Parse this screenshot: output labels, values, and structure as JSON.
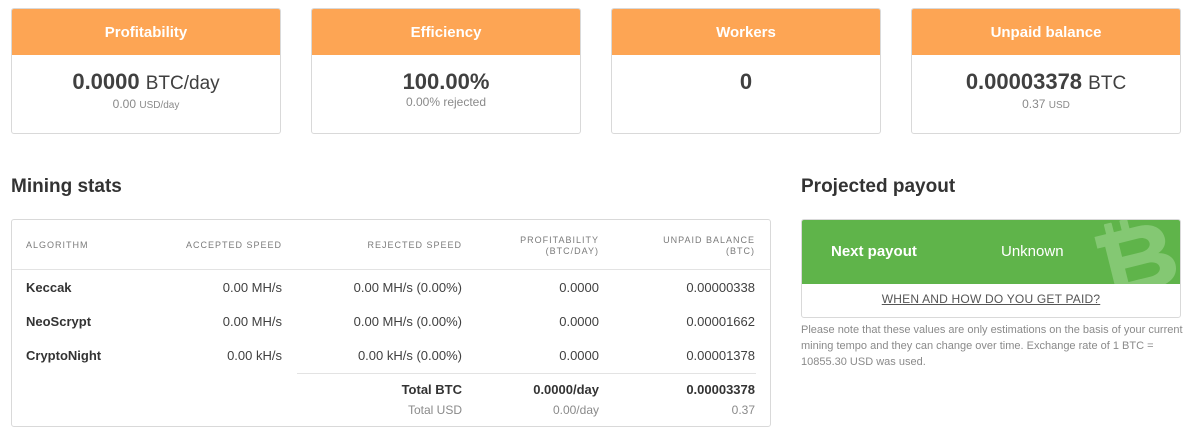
{
  "cards": [
    {
      "title": "Profitability",
      "value": "0.0000",
      "unit": "BTC/day",
      "sub_value": "0.00",
      "sub_unit": "USD/day"
    },
    {
      "title": "Efficiency",
      "value": "100.00%",
      "unit": "",
      "sub_value": "0.00% rejected",
      "sub_unit": ""
    },
    {
      "title": "Workers",
      "value": "0",
      "unit": "",
      "sub_value": "",
      "sub_unit": ""
    },
    {
      "title": "Unpaid balance",
      "value": "0.00003378",
      "unit": "BTC",
      "sub_value": "0.37",
      "sub_unit": "USD"
    }
  ],
  "mining_stats": {
    "title": "Mining stats",
    "headers": {
      "algorithm": "ALGORITHM",
      "accepted": "ACCEPTED SPEED",
      "rejected": "REJECTED SPEED",
      "profitability_1": "PROFITABILITY",
      "profitability_2": "(BTC/DAY)",
      "unpaid_1": "UNPAID BALANCE",
      "unpaid_2": "(BTC)"
    },
    "rows": [
      {
        "algorithm": "Keccak",
        "accepted": "0.00 MH/s",
        "rejected": "0.00 MH/s (0.00%)",
        "profitability": "0.0000",
        "unpaid": "0.00000338"
      },
      {
        "algorithm": "NeoScrypt",
        "accepted": "0.00 MH/s",
        "rejected": "0.00 MH/s (0.00%)",
        "profitability": "0.0000",
        "unpaid": "0.00001662"
      },
      {
        "algorithm": "CryptoNight",
        "accepted": "0.00 kH/s",
        "rejected": "0.00 kH/s (0.00%)",
        "profitability": "0.0000",
        "unpaid": "0.00001378"
      }
    ],
    "totals": {
      "btc_label": "Total BTC",
      "btc_profitability": "0.0000/day",
      "btc_unpaid": "0.00003378",
      "usd_label": "Total USD",
      "usd_profitability": "0.00/day",
      "usd_unpaid": "0.37"
    }
  },
  "payout": {
    "title": "Projected payout",
    "next_label": "Next payout",
    "next_value": "Unknown",
    "link": "WHEN AND HOW DO YOU GET PAID?",
    "note": "Please note that these values are only estimations on the basis of your current mining tempo and they can change over time. Exchange rate of 1 BTC = 10855.30 USD was used.",
    "icon": "bitcoin-icon"
  },
  "colors": {
    "header_orange": "#fda554",
    "payout_green": "#5fb44a"
  }
}
